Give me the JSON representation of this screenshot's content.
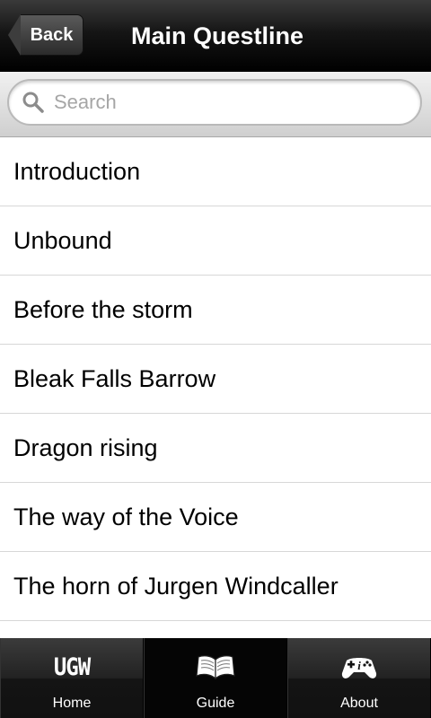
{
  "navbar": {
    "back_label": "Back",
    "title": "Main Questline"
  },
  "search": {
    "placeholder": "Search",
    "value": ""
  },
  "quests": [
    "Introduction",
    "Unbound",
    "Before the storm",
    "Bleak Falls Barrow",
    "Dragon rising",
    "The way of the Voice",
    "The horn of Jurgen Windcaller",
    ""
  ],
  "tabbar": {
    "tabs": [
      {
        "label": "Home",
        "icon": "ugw-logo-icon"
      },
      {
        "label": "Guide",
        "icon": "book-icon"
      },
      {
        "label": "About",
        "icon": "gamepad-info-icon"
      }
    ],
    "home_logo_text": "UGW",
    "active_tab": "Guide"
  }
}
